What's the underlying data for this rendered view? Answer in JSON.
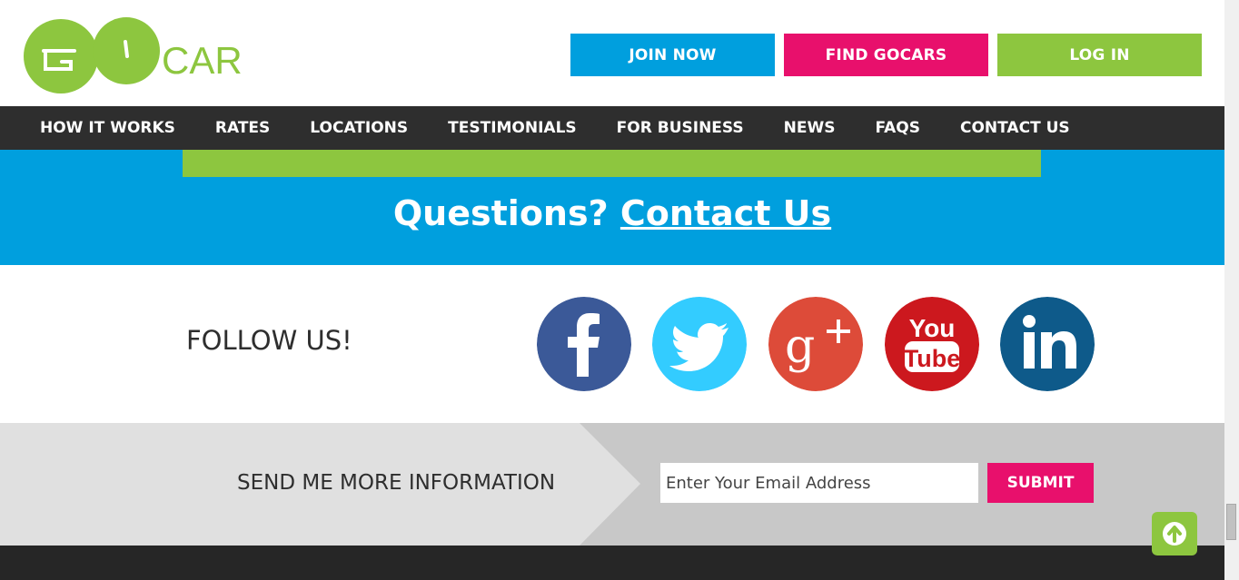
{
  "brand": {
    "logo_text": "GO CAR",
    "logo_color": "#8dc63f"
  },
  "header": {
    "join_label": "JOIN NOW",
    "find_label": "FIND GOCARS",
    "login_label": "LOG IN"
  },
  "nav": {
    "items": [
      "HOW IT WORKS",
      "RATES",
      "LOCATIONS",
      "TESTIMONIALS",
      "FOR BUSINESS",
      "NEWS",
      "FAQS",
      "CONTACT US"
    ]
  },
  "contact": {
    "question": "Questions? ",
    "link": "Contact Us"
  },
  "follow": {
    "title": "FOLLOW US!",
    "networks": [
      {
        "name": "facebook-icon",
        "color": "#3b5998"
      },
      {
        "name": "twitter-icon",
        "color": "#33ccff"
      },
      {
        "name": "google-plus-icon",
        "color": "#dd4b39"
      },
      {
        "name": "youtube-icon",
        "color": "#cc181e"
      },
      {
        "name": "linkedin-icon",
        "color": "#0e5a8a"
      }
    ],
    "youtube_text_top": "You",
    "youtube_text_bottom": "Tube"
  },
  "newsletter": {
    "title": "SEND ME MORE INFORMATION",
    "email_placeholder": "Enter Your Email Address",
    "submit_label": "SUBMIT"
  },
  "colors": {
    "blue": "#009fde",
    "pink": "#e8106c",
    "green": "#8dc63f",
    "dark": "#2e2e2e"
  }
}
